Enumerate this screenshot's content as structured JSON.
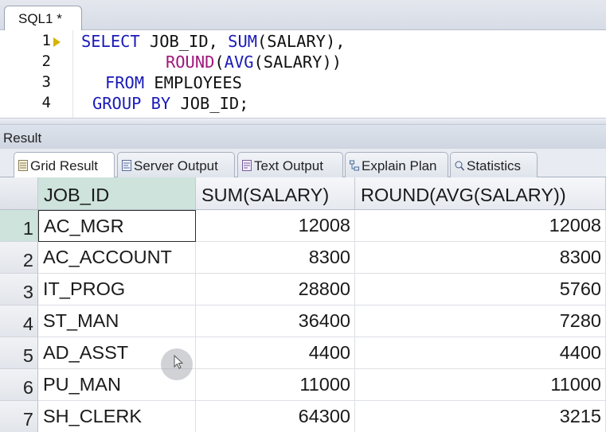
{
  "editor": {
    "tab_title": "SQL1 *",
    "line_numbers": [
      "1",
      "2",
      "3",
      "4"
    ],
    "lines": [
      {
        "kw1": "SELECT",
        "t1": " JOB_ID, ",
        "kw2": "SUM",
        "t2": "(SALARY),"
      },
      {
        "fn": "ROUND",
        "t1": "(",
        "kw": "AVG",
        "t2": "(SALARY))"
      },
      {
        "kw": "FROM",
        "t": " EMPLOYEES"
      },
      {
        "kw": "GROUP BY",
        "t": " JOB_ID;"
      }
    ],
    "run_marker_icon": "current-line-arrow-icon"
  },
  "result": {
    "title": "Result",
    "tabs": [
      {
        "label": "Grid Result",
        "icon": "grid-icon",
        "active": true
      },
      {
        "label": "Server Output",
        "icon": "server-output-icon",
        "active": false
      },
      {
        "label": "Text Output",
        "icon": "text-output-icon",
        "active": false
      },
      {
        "label": "Explain Plan",
        "icon": "explain-plan-icon",
        "active": false
      },
      {
        "label": "Statistics",
        "icon": "statistics-icon",
        "active": false
      }
    ],
    "columns": [
      "JOB_ID",
      "SUM(SALARY)",
      "ROUND(AVG(SALARY))"
    ],
    "rows": [
      {
        "n": "1",
        "job_id": "AC_MGR",
        "sum": "12008",
        "avg": "12008"
      },
      {
        "n": "2",
        "job_id": "AC_ACCOUNT",
        "sum": "8300",
        "avg": "8300"
      },
      {
        "n": "3",
        "job_id": "IT_PROG",
        "sum": "28800",
        "avg": "5760"
      },
      {
        "n": "4",
        "job_id": "ST_MAN",
        "sum": "36400",
        "avg": "7280"
      },
      {
        "n": "5",
        "job_id": "AD_ASST",
        "sum": "4400",
        "avg": "4400"
      },
      {
        "n": "6",
        "job_id": "PU_MAN",
        "sum": "11000",
        "avg": "11000"
      },
      {
        "n": "7",
        "job_id": "SH_CLERK",
        "sum": "64300",
        "avg": "3215"
      }
    ]
  },
  "colors": {
    "keyword": "#1a1ab8",
    "function": "#a0167b",
    "selection": "#cde3dc"
  }
}
